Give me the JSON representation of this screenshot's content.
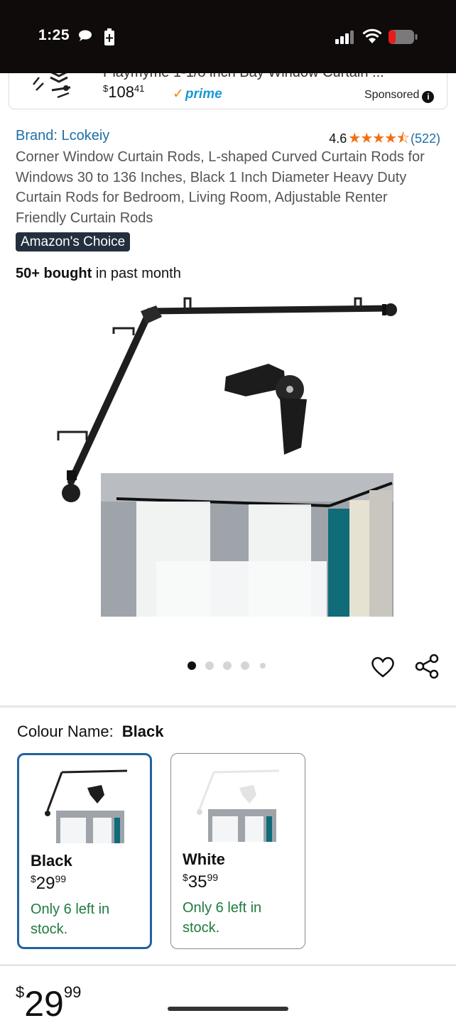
{
  "status_bar": {
    "time": "1:25"
  },
  "ad": {
    "title": "Playmyme 1-1/8 inch Bay Window Curtain ...",
    "price_currency": "$",
    "price_whole": "108",
    "price_fraction": "41",
    "prime_label": "prime",
    "sponsored_label": "Sponsored",
    "info_symbol": "i"
  },
  "product": {
    "brand": "Brand: Lcokeiy",
    "rating_value": "4.6",
    "rating_stars": "★★★★⯪",
    "rating_count": "(522)",
    "title": "Corner Window Curtain Rods, L-shaped Curved Curtain Rods for Windows 30 to 136 Inches, Black 1 Inch Diameter Heavy Duty Curtain Rods for Bedroom, Living Room, Adjustable Renter Friendly Curtain Rods",
    "badge": "Amazon's Choice",
    "bought_bold": "50+ bought",
    "bought_rest": " in past month"
  },
  "carousel": {
    "total_dots": 5,
    "active_index": 0
  },
  "colour": {
    "label": "Colour Name:",
    "selected": "Black",
    "options": [
      {
        "name": "Black",
        "price_currency": "$",
        "price_whole": "29",
        "price_fraction": "99",
        "stock": "Only 6 left in stock."
      },
      {
        "name": "White",
        "price_currency": "$",
        "price_whole": "35",
        "price_fraction": "99",
        "stock": "Only 6 left in stock."
      }
    ]
  },
  "bottom_price": {
    "currency": "$",
    "whole": "29",
    "fraction": "99"
  },
  "colors": {
    "link": "#1f6fa6",
    "stars": "#f36f12",
    "stock": "#1f7a3f",
    "selected_border": "#2162a1",
    "badge_bg": "#232f3e",
    "prime": "#1a98d5"
  }
}
